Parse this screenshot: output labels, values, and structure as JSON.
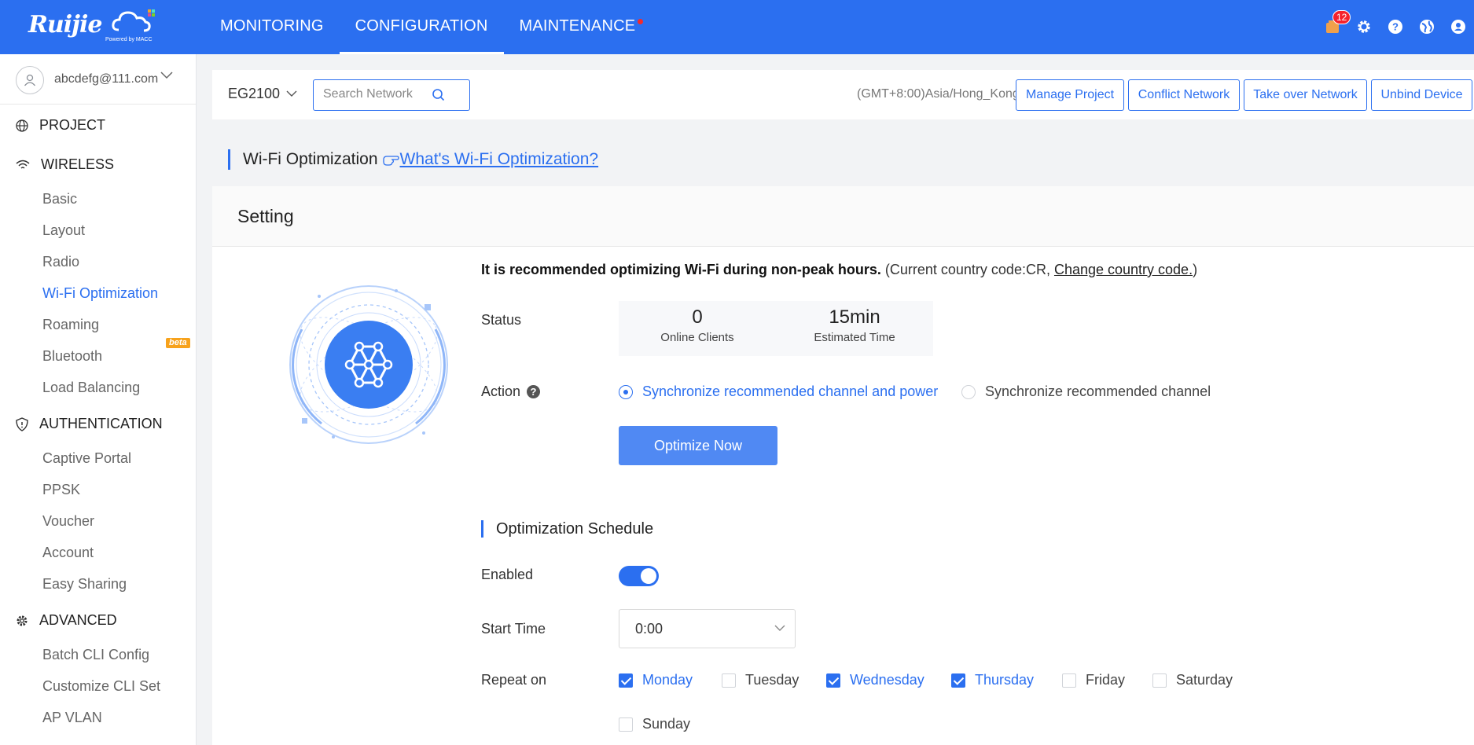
{
  "brand": {
    "logo_text": "Ruijie",
    "powered_by": "Powered by MACC"
  },
  "topnav": {
    "tabs": [
      {
        "label": "MONITORING"
      },
      {
        "label": "CONFIGURATION"
      },
      {
        "label": "MAINTENANCE"
      }
    ],
    "notification_count": "12"
  },
  "user": {
    "email": "abcdefg@111.com"
  },
  "sidebar": {
    "project": "PROJECT",
    "wireless": "WIRELESS",
    "wireless_items": [
      "Basic",
      "Layout",
      "Radio",
      "Wi-Fi Optimization",
      "Roaming",
      "Bluetooth",
      "Load Balancing"
    ],
    "beta": "beta",
    "authentication": "AUTHENTICATION",
    "auth_items": [
      "Captive Portal",
      "PPSK",
      "Voucher",
      "Account",
      "Easy Sharing"
    ],
    "advanced": "ADVANCED",
    "advanced_items": [
      "Batch CLI Config",
      "Customize CLI Set",
      "AP VLAN"
    ]
  },
  "toolbar": {
    "device": "EG2100",
    "search_placeholder": "Search Network",
    "timezone": "(GMT+8:00)Asia/Hong_Kong",
    "buttons": [
      "Manage Project",
      "Conflict Network",
      "Take over Network",
      "Unbind Device"
    ]
  },
  "page": {
    "title": "Wi-Fi Optimization",
    "help_link": "What's Wi-Fi Optimization?"
  },
  "setting": {
    "title": "Setting",
    "recommend_bold": "It is recommended optimizing Wi-Fi during non-peak hours.",
    "recommend_pre": "(Current country code:CR, ",
    "recommend_link": "Change country code.",
    "recommend_post": ")",
    "status_label": "Status",
    "online_clients_value": "0",
    "online_clients_label": "Online Clients",
    "estimated_time_value": "15min",
    "estimated_time_label": "Estimated Time",
    "action_label": "Action",
    "action_options": [
      "Synchronize recommended channel and power",
      "Synchronize recommended channel"
    ],
    "action_selected": 0,
    "optimize_button": "Optimize Now"
  },
  "schedule": {
    "title": "Optimization Schedule",
    "enabled_label": "Enabled",
    "enabled": true,
    "start_time_label": "Start Time",
    "start_time": "0:00",
    "repeat_label": "Repeat on",
    "days": [
      {
        "label": "Monday",
        "checked": true
      },
      {
        "label": "Tuesday",
        "checked": false
      },
      {
        "label": "Wednesday",
        "checked": true
      },
      {
        "label": "Thursday",
        "checked": true
      },
      {
        "label": "Friday",
        "checked": false
      },
      {
        "label": "Saturday",
        "checked": false
      },
      {
        "label": "Sunday",
        "checked": false
      }
    ]
  },
  "colors": {
    "primary": "#2b6ff0",
    "button": "#5089f3",
    "beta": "#f7a21b",
    "alert": "#f5222d"
  }
}
